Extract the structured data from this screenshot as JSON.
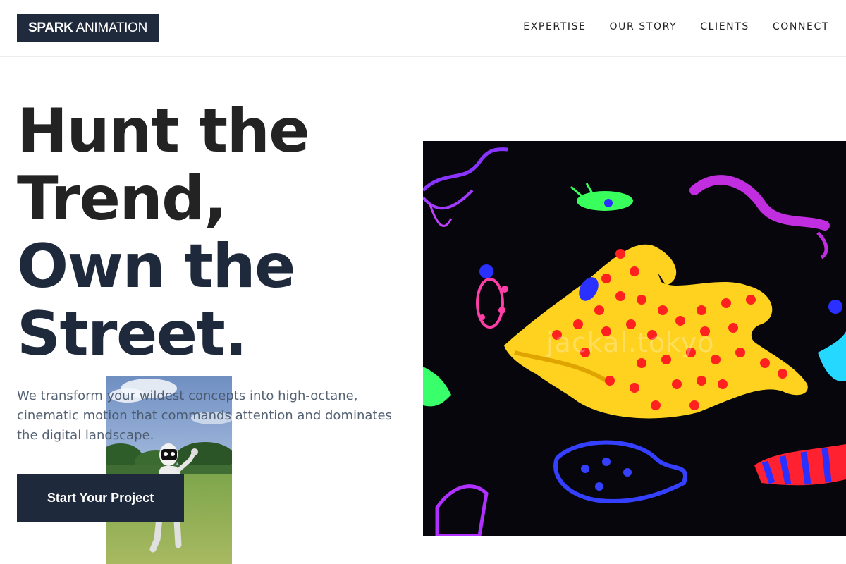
{
  "brand": {
    "bold": "SPARK",
    "light": "ANIMATION"
  },
  "nav": {
    "items": [
      {
        "label": "EXPERTISE"
      },
      {
        "label": "OUR STORY"
      },
      {
        "label": "CLIENTS"
      },
      {
        "label": "CONNECT"
      }
    ]
  },
  "hero": {
    "title_line1": "Hunt the",
    "title_line2": "Trend,",
    "title_line3": "Own the",
    "title_line4": "Street.",
    "subtitle": "We transform your wildest concepts into high-octane, cinematic motion that commands attention and dominates the digital landscape.",
    "cta_label": "Start Your Project"
  },
  "artwork": {
    "watermark": "jackal.tokyo"
  },
  "colors": {
    "navy": "#1e293b",
    "logo_bg": "#1f2a3c",
    "text_dark": "#232323",
    "subtitle": "#475569"
  }
}
